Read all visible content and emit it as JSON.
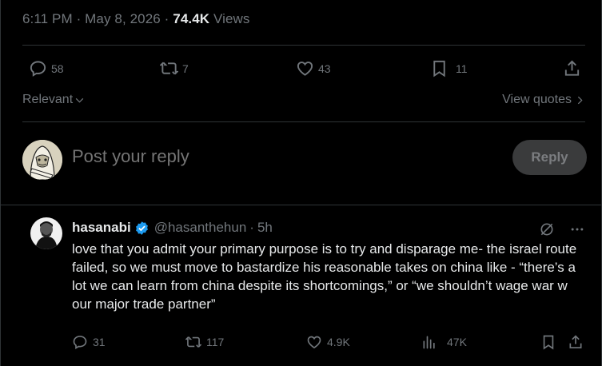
{
  "post_meta": {
    "time": "6:11 PM",
    "sep1": "·",
    "date": "May 8, 2026",
    "sep2": "·",
    "views_count": "74.4K",
    "views_label": "Views"
  },
  "post_actions": {
    "replies": "58",
    "reposts": "7",
    "likes": "43",
    "bookmarks": "11"
  },
  "sort": {
    "relevant_label": "Relevant",
    "view_quotes_label": "View quotes"
  },
  "composer": {
    "placeholder": "Post your reply",
    "reply_button": "Reply"
  },
  "reply_tweet": {
    "name": "hasanabi",
    "handle": "@hasanthehun",
    "sep": "·",
    "time": "5h",
    "text": "love that you admit your primary purpose is to try and disparage me- the israel route failed, so we must move to bastardize his reasonable takes on china like - “there’s a lot we can learn from china despite its shortcomings,” or “we shouldn’t wage war w our major trade partner”",
    "replies": "31",
    "reposts": "117",
    "likes": "4.9K",
    "views": "47K"
  },
  "colors": {
    "background": "#000000",
    "text_primary": "#e7e9ea",
    "text_secondary": "#71767b",
    "border": "#2f3336",
    "verified_blue": "#1d9bf0",
    "reply_button_bg": "#3a3b3c"
  },
  "icons": [
    "reply-icon",
    "repost-icon",
    "like-icon",
    "bookmark-icon",
    "share-icon",
    "chevron-down-icon",
    "chevron-right-icon",
    "verified-badge-icon",
    "grok-icon",
    "more-icon",
    "views-icon"
  ]
}
